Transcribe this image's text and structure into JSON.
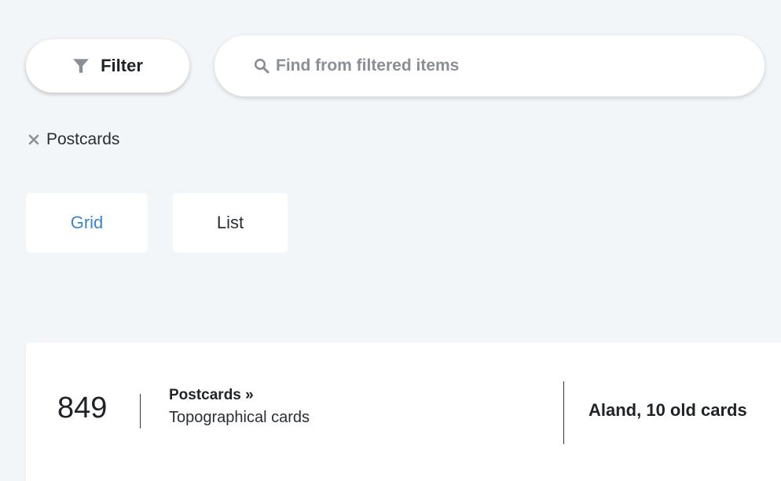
{
  "toolbar": {
    "filter_label": "Filter",
    "filter_icon": "funnel-icon",
    "search_icon": "magnifier-icon",
    "search_placeholder": "Find from filtered items",
    "search_value": ""
  },
  "active_filters": [
    {
      "label": "Postcards",
      "remove_icon": "x-icon"
    }
  ],
  "view": {
    "options": [
      "Grid",
      "List"
    ],
    "selected": "Grid"
  },
  "results": [
    {
      "count": "849",
      "breadcrumb": "Postcards »",
      "subcategory": "Topographical cards",
      "title": "Aland, 10 old cards"
    }
  ],
  "colors": {
    "background": "#f3f6f9",
    "accent": "#3d86c6",
    "icon_gray": "#8a8f95",
    "text": "#1f2328"
  }
}
